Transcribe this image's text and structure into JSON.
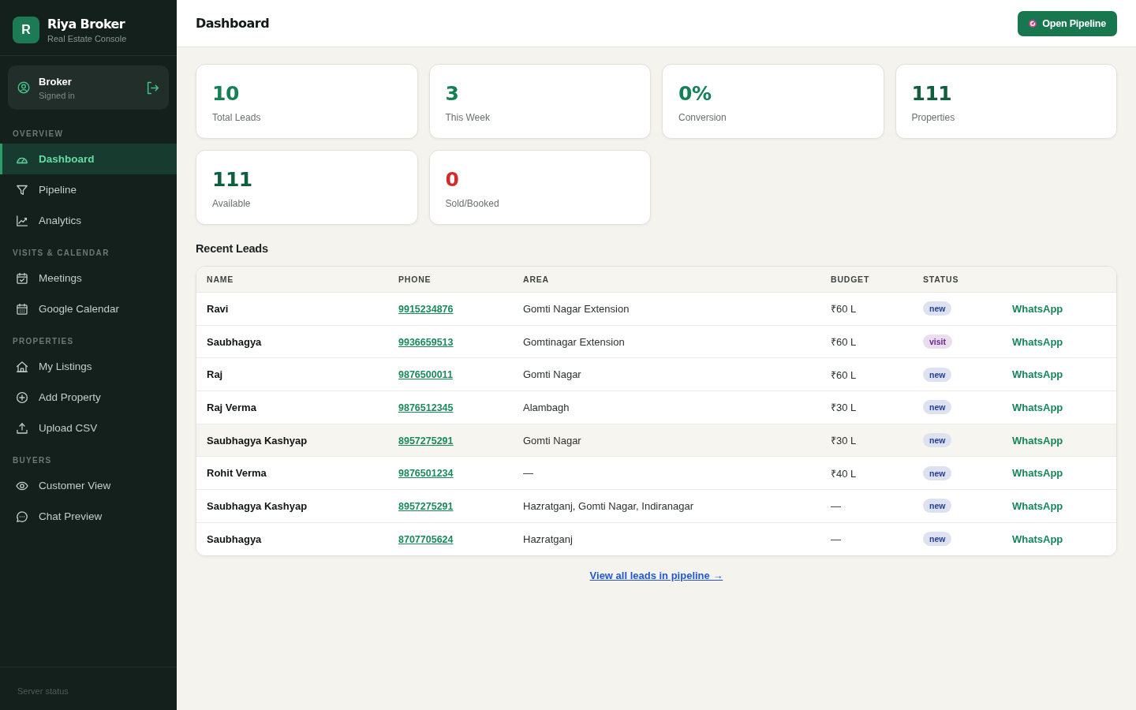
{
  "sidebar": {
    "brand": {
      "logo_letter": "R",
      "title": "Riya Broker",
      "subtitle": "Real Estate Console"
    },
    "user": {
      "name": "Broker",
      "status": "Signed in"
    },
    "sections": [
      {
        "title": "OVERVIEW",
        "items": [
          {
            "label": "Dashboard",
            "selected": true
          },
          {
            "label": "Pipeline",
            "selected": false
          },
          {
            "label": "Analytics",
            "selected": false
          }
        ]
      },
      {
        "title": "VISITS & CALENDAR",
        "items": [
          {
            "label": "Meetings",
            "selected": false
          },
          {
            "label": "Google Calendar",
            "selected": false
          }
        ]
      },
      {
        "title": "PROPERTIES",
        "items": [
          {
            "label": "My Listings",
            "selected": false
          },
          {
            "label": "Add Property",
            "selected": false
          },
          {
            "label": "Upload CSV",
            "selected": false
          }
        ]
      },
      {
        "title": "BUYERS",
        "items": [
          {
            "label": "Customer View",
            "selected": false
          },
          {
            "label": "Chat Preview",
            "selected": false
          }
        ]
      }
    ],
    "footer": "Server status"
  },
  "header": {
    "title": "Dashboard",
    "button": "Open Pipeline"
  },
  "stats": [
    {
      "value": "10",
      "label": "Total Leads",
      "color": "#168055"
    },
    {
      "value": "3",
      "label": "This Week",
      "color": "#168055"
    },
    {
      "value": "0%",
      "label": "Conversion",
      "color": "#168055"
    },
    {
      "value": "111",
      "label": "Properties",
      "color": "#0f5f3f"
    },
    {
      "value": "111",
      "label": "Available",
      "color": "#0f5f3f"
    },
    {
      "value": "0",
      "label": "Sold/Booked",
      "color": "#d42a2a"
    }
  ],
  "recent_leads": {
    "title": "Recent Leads",
    "table": {
      "columns": [
        "NAME",
        "PHONE",
        "AREA",
        "BUDGET",
        "STATUS"
      ],
      "rows": [
        {
          "name": "Ravi",
          "phone": "9915234876",
          "area": "Gomti Nagar Extension",
          "budget": "₹60 L",
          "status": {
            "label": "new",
            "color": "#22409a"
          },
          "action": "WhatsApp",
          "highlighted": false
        },
        {
          "name": "Saubhagya",
          "phone": "9936659513",
          "area": "Gomtinagar Extension",
          "budget": "₹60 L",
          "status": {
            "label": "visit",
            "color": "#6d2292"
          },
          "action": "WhatsApp",
          "highlighted": false
        },
        {
          "name": "Raj",
          "phone": "9876500011",
          "area": "Gomti Nagar",
          "budget": "₹60 L",
          "status": {
            "label": "new",
            "color": "#22409a"
          },
          "action": "WhatsApp",
          "highlighted": false
        },
        {
          "name": "Raj Verma",
          "phone": "9876512345",
          "area": "Alambagh",
          "budget": "₹30 L",
          "status": {
            "label": "new",
            "color": "#22409a"
          },
          "action": "WhatsApp",
          "highlighted": false
        },
        {
          "name": "Saubhagya Kashyap",
          "phone": "8957275291",
          "area": "Gomti Nagar",
          "budget": "₹30 L",
          "status": {
            "label": "new",
            "color": "#22409a"
          },
          "action": "WhatsApp",
          "highlighted": true
        },
        {
          "name": "Rohit Verma",
          "phone": "9876501234",
          "area": "—",
          "budget": "₹40 L",
          "status": {
            "label": "new",
            "color": "#22409a"
          },
          "action": "WhatsApp",
          "highlighted": false
        },
        {
          "name": "Saubhagya Kashyap",
          "phone": "8957275291",
          "area": "Hazratganj, Gomti Nagar, Indiranagar",
          "budget": "—",
          "status": {
            "label": "new",
            "color": "#22409a"
          },
          "action": "WhatsApp",
          "highlighted": false
        },
        {
          "name": "Saubhagya",
          "phone": "8707705624",
          "area": "Hazratganj",
          "budget": "—",
          "status": {
            "label": "new",
            "color": "#22409a"
          },
          "action": "WhatsApp",
          "highlighted": false
        }
      ]
    },
    "link": "View all leads in pipeline →"
  }
}
